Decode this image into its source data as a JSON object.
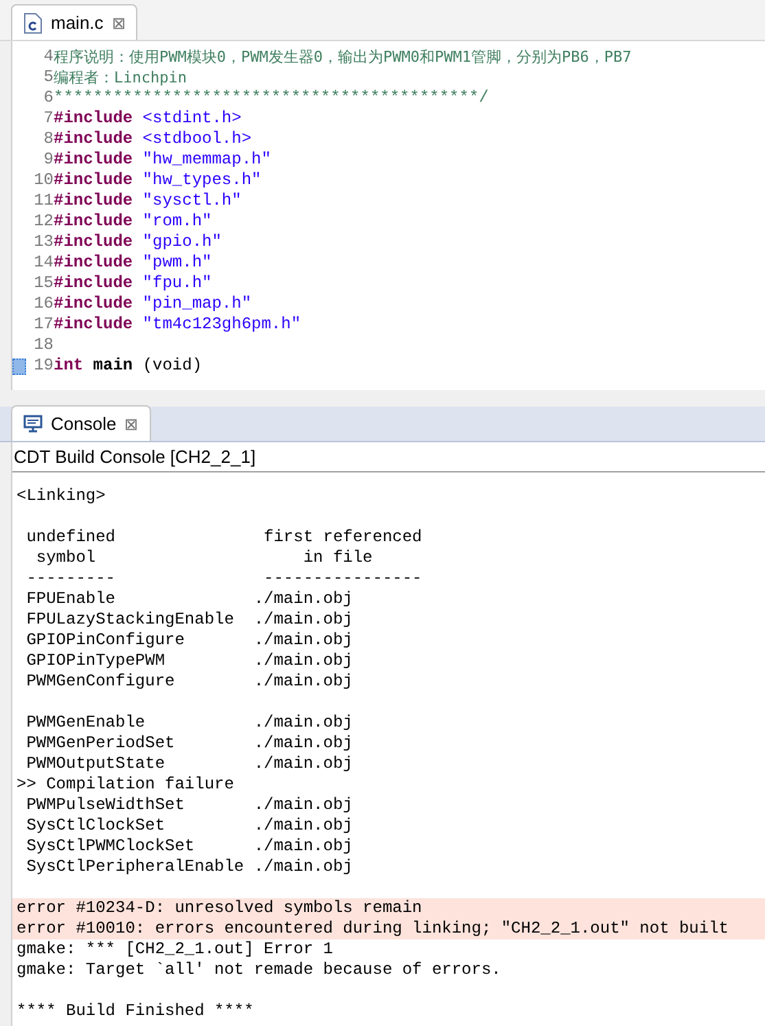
{
  "editor": {
    "tab": {
      "title": "main.c",
      "close": "⊠",
      "selected": true
    },
    "lines": [
      {
        "number": "4",
        "segments": [
          {
            "kind": "comment",
            "text": "程序说明：使用PWM模块0，PWM发生器0，输出为PWM0和PWM1管脚，分别为PB6，PB7"
          }
        ]
      },
      {
        "number": "5",
        "segments": [
          {
            "kind": "comment",
            "text": "编程者：Linchpin"
          }
        ]
      },
      {
        "number": "6",
        "segments": [
          {
            "kind": "comment",
            "text": "*******************************************/"
          }
        ]
      },
      {
        "number": "7",
        "segments": [
          {
            "kind": "keyword",
            "text": "#include"
          },
          {
            "kind": "string",
            "text": " <stdint.h>"
          }
        ]
      },
      {
        "number": "8",
        "segments": [
          {
            "kind": "keyword",
            "text": "#include"
          },
          {
            "kind": "string",
            "text": " <stdbool.h>"
          }
        ]
      },
      {
        "number": "9",
        "segments": [
          {
            "kind": "keyword",
            "text": "#include"
          },
          {
            "kind": "string",
            "text": " \"hw_memmap.h\""
          }
        ]
      },
      {
        "number": "10",
        "segments": [
          {
            "kind": "keyword",
            "text": "#include"
          },
          {
            "kind": "string",
            "text": " \"hw_types.h\""
          }
        ]
      },
      {
        "number": "11",
        "segments": [
          {
            "kind": "keyword",
            "text": "#include"
          },
          {
            "kind": "string",
            "text": " \"sysctl.h\""
          }
        ]
      },
      {
        "number": "12",
        "segments": [
          {
            "kind": "keyword",
            "text": "#include"
          },
          {
            "kind": "string",
            "text": " \"rom.h\""
          }
        ]
      },
      {
        "number": "13",
        "segments": [
          {
            "kind": "keyword",
            "text": "#include"
          },
          {
            "kind": "string",
            "text": " \"gpio.h\""
          }
        ]
      },
      {
        "number": "14",
        "segments": [
          {
            "kind": "keyword",
            "text": "#include"
          },
          {
            "kind": "string",
            "text": " \"pwm.h\""
          }
        ]
      },
      {
        "number": "15",
        "segments": [
          {
            "kind": "keyword",
            "text": "#include"
          },
          {
            "kind": "string",
            "text": " \"fpu.h\""
          }
        ]
      },
      {
        "number": "16",
        "segments": [
          {
            "kind": "keyword",
            "text": "#include"
          },
          {
            "kind": "string",
            "text": " \"pin_map.h\""
          }
        ]
      },
      {
        "number": "17",
        "segments": [
          {
            "kind": "keyword",
            "text": "#include"
          },
          {
            "kind": "string",
            "text": " \"tm4c123gh6pm.h\""
          }
        ]
      },
      {
        "number": "18"
      },
      {
        "number": "19",
        "marker": true,
        "segments": [
          {
            "kind": "keyword",
            "text": "int"
          },
          {
            "kind": "bold",
            "text": " main"
          },
          {
            "kind": "plain",
            "text": " (void)"
          }
        ]
      }
    ]
  },
  "console": {
    "tab": {
      "title": "Console",
      "close": "⊠",
      "selected": true
    },
    "header": "CDT Build Console [CH2_2_1]",
    "lines": [
      {
        "kind": "normal",
        "text": "<Linking>"
      },
      {
        "kind": "blank"
      },
      {
        "kind": "normal",
        "text": " undefined               first referenced"
      },
      {
        "kind": "normal",
        "text": "  symbol                     in file"
      },
      {
        "kind": "normal",
        "text": " ---------               ----------------"
      },
      {
        "kind": "normal",
        "text": " FPUEnable              ./main.obj"
      },
      {
        "kind": "normal",
        "text": " FPULazyStackingEnable  ./main.obj"
      },
      {
        "kind": "normal",
        "text": " GPIOPinConfigure       ./main.obj"
      },
      {
        "kind": "normal",
        "text": " GPIOPinTypePWM         ./main.obj"
      },
      {
        "kind": "normal",
        "text": " PWMGenConfigure        ./main.obj"
      },
      {
        "kind": "blank"
      },
      {
        "kind": "normal",
        "text": " PWMGenEnable           ./main.obj"
      },
      {
        "kind": "normal",
        "text": " PWMGenPeriodSet        ./main.obj"
      },
      {
        "kind": "normal",
        "text": " PWMOutputState         ./main.obj"
      },
      {
        "kind": "normal",
        "text": ">> Compilation failure"
      },
      {
        "kind": "normal",
        "text": " PWMPulseWidthSet       ./main.obj"
      },
      {
        "kind": "normal",
        "text": " SysCtlClockSet         ./main.obj"
      },
      {
        "kind": "normal",
        "text": " SysCtlPWMClockSet      ./main.obj"
      },
      {
        "kind": "normal",
        "text": " SysCtlPeripheralEnable ./main.obj"
      },
      {
        "kind": "blank"
      },
      {
        "kind": "error",
        "text": "error #10234-D: unresolved symbols remain"
      },
      {
        "kind": "error",
        "text": "error #10010: errors encountered during linking; \"CH2_2_1.out\" not built"
      },
      {
        "kind": "normal",
        "text": "gmake: *** [CH2_2_1.out] Error 1"
      },
      {
        "kind": "normal",
        "text": "gmake: Target `all' not remade because of errors."
      },
      {
        "kind": "blank"
      },
      {
        "kind": "normal",
        "text": "**** Build Finished ****"
      }
    ]
  }
}
